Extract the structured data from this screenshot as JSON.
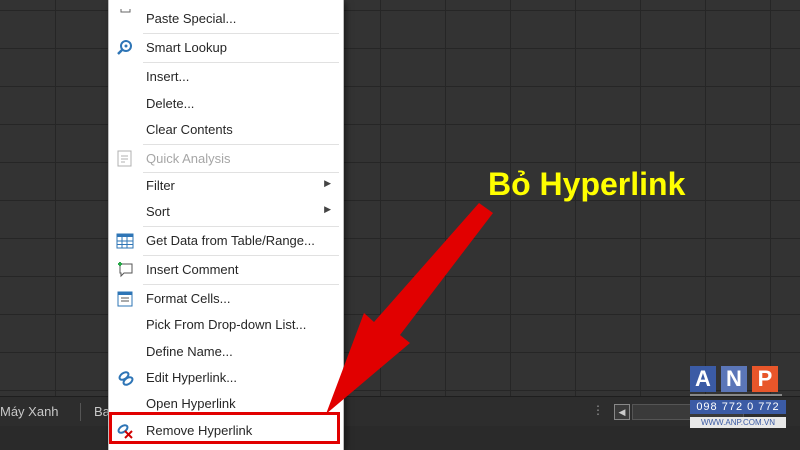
{
  "sheet": {
    "tab_1": "Máy Xanh",
    "tab_2": "Ba",
    "dots": "⋮"
  },
  "context_menu": {
    "items": [
      {
        "label": "Paste Special...",
        "icon": "paste-icon",
        "enabled": true
      },
      {
        "label": "Smart Lookup",
        "icon": "smart-lookup-icon",
        "enabled": true
      },
      {
        "label": "Insert...",
        "icon": "",
        "enabled": true
      },
      {
        "label": "Delete...",
        "icon": "",
        "enabled": true
      },
      {
        "label": "Clear Contents",
        "icon": "",
        "enabled": true
      },
      {
        "label": "Quick Analysis",
        "icon": "quick-analysis-icon",
        "enabled": false
      },
      {
        "label": "Filter",
        "icon": "",
        "enabled": true,
        "submenu": true
      },
      {
        "label": "Sort",
        "icon": "",
        "enabled": true,
        "submenu": true
      },
      {
        "label": "Get Data from Table/Range...",
        "icon": "table-icon",
        "enabled": true
      },
      {
        "label": "Insert Comment",
        "icon": "comment-icon",
        "enabled": true
      },
      {
        "label": "Format Cells...",
        "icon": "format-cells-icon",
        "enabled": true
      },
      {
        "label": "Pick From Drop-down List...",
        "icon": "",
        "enabled": true
      },
      {
        "label": "Define Name...",
        "icon": "",
        "enabled": true
      },
      {
        "label": "Edit Hyperlink...",
        "icon": "edit-hyperlink-icon",
        "enabled": true
      },
      {
        "label": "Open Hyperlink",
        "icon": "",
        "enabled": true
      },
      {
        "label": "Remove Hyperlink",
        "icon": "remove-hyperlink-icon",
        "enabled": true
      }
    ]
  },
  "annotation": {
    "text": "Bỏ Hyperlink",
    "color": "#ffff00",
    "arrow_color": "#e10000"
  },
  "logo": {
    "letters": [
      "A",
      "N",
      "P"
    ],
    "phone": "098 772 0 772",
    "url": "WWW.ANP.COM.VN"
  }
}
